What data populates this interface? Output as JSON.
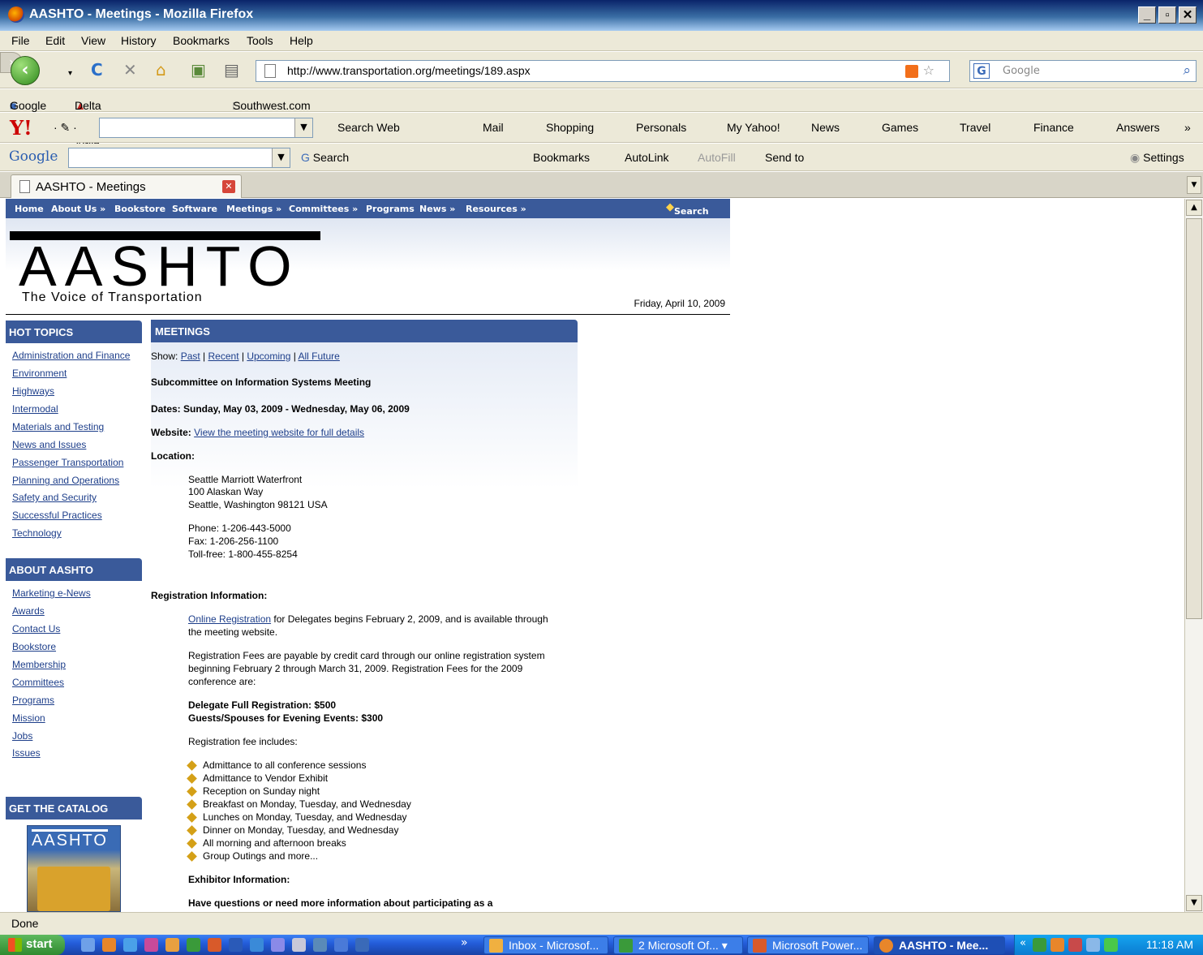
{
  "window": {
    "title": "AASHTO - Meetings - Mozilla Firefox"
  },
  "menubar": [
    "File",
    "Edit",
    "View",
    "History",
    "Bookmarks",
    "Tools",
    "Help"
  ],
  "navbar": {
    "url": "http://www.transportation.org/meetings/189.aspx",
    "search_placeholder": "Google"
  },
  "bookmarks": [
    "Google",
    "Delta Air Lines - Airlin...",
    "Southwest.com"
  ],
  "yahoo_toolbar": [
    "Search Web",
    "Mail",
    "Shopping",
    "Personals",
    "My Yahoo!",
    "News",
    "Games",
    "Travel",
    "Finance",
    "Answers"
  ],
  "google_toolbar": [
    "Search",
    "Bookmarks",
    "AutoLink",
    "AutoFill",
    "Send to",
    "Settings"
  ],
  "google_logo": "Google",
  "tab": {
    "title": "AASHTO - Meetings"
  },
  "site": {
    "nav": [
      "Home",
      "About Us »",
      "Bookstore",
      "Software",
      "Meetings »",
      "Committees »",
      "Programs",
      "News »",
      "Resources »"
    ],
    "search_label": "Search",
    "logo": "AASHTO",
    "tagline": "The Voice of Transportation",
    "date": "Friday, April 10, 2009"
  },
  "sidebar": {
    "hot_topics_title": "HOT TOPICS",
    "hot_topics": [
      "Administration and Finance",
      "Environment",
      "Highways",
      "Intermodal",
      "Materials and Testing",
      "News and Issues",
      "Passenger Transportation",
      "Planning and Operations",
      "Safety and Security",
      "Successful Practices",
      "Technology"
    ],
    "about_title": "ABOUT AASHTO",
    "about": [
      "Marketing e-News",
      "Awards",
      "Contact Us",
      "Bookstore",
      "Membership",
      "Committees",
      "Programs",
      "Mission",
      "Jobs",
      "Issues"
    ],
    "catalog_title": "GET THE CATALOG",
    "catalog_logo": "AASHTO"
  },
  "main": {
    "title": "MEETINGS",
    "show_label": "Show:",
    "show_links": [
      "Past",
      "Recent",
      "Upcoming",
      "All Future"
    ],
    "meeting_name": "Subcommittee on Information Systems Meeting",
    "dates": "Dates: Sunday, May 03, 2009 - Wednesday, May 06, 2009",
    "website_label": "Website:",
    "website_link": "View the meeting website for full details",
    "location_label": "Location:",
    "location": [
      "Seattle Marriott Waterfront",
      "100 Alaskan Way",
      "Seattle, Washington 98121 USA"
    ],
    "phones": [
      "Phone: 1-206-443-5000",
      "Fax: 1-206-256-1100",
      "Toll-free: 1-800-455-8254"
    ],
    "registration_label": "Registration Information:",
    "reg_link": "Online Registration",
    "reg_line1": "for Delegates begins February 2, 2009, and is available through",
    "reg_line2": "the meeting website.",
    "fees_lines": [
      "Registration Fees are payable by credit card through our online registration system",
      "beginning February 2 through March 31, 2009. Registration Fees for the 2009",
      "conference are:"
    ],
    "fee_delegate": "Delegate Full Registration: $500",
    "fee_guest": "Guests/Spouses for Evening Events: $300",
    "includes_label": "Registration fee includes:",
    "includes": [
      "Admittance to all conference sessions",
      "Admittance to Vendor Exhibit",
      "Reception on Sunday night",
      "Breakfast on Monday, Tuesday, and Wednesday",
      "Lunches on Monday, Tuesday, and Wednesday",
      "Dinner on Monday, Tuesday, and Wednesday",
      "All morning and afternoon breaks",
      "Group Outings and more..."
    ],
    "exhibitor_label": "Exhibitor Information:",
    "questions": "Have questions or need more information about participating as a"
  },
  "status": "Done",
  "taskbar": {
    "start": "start",
    "tasks": [
      "Inbox - Microsof...",
      "2 Microsoft Of...",
      "Microsoft Power...",
      "AASHTO - Mee..."
    ],
    "clock": "11:18 AM"
  }
}
